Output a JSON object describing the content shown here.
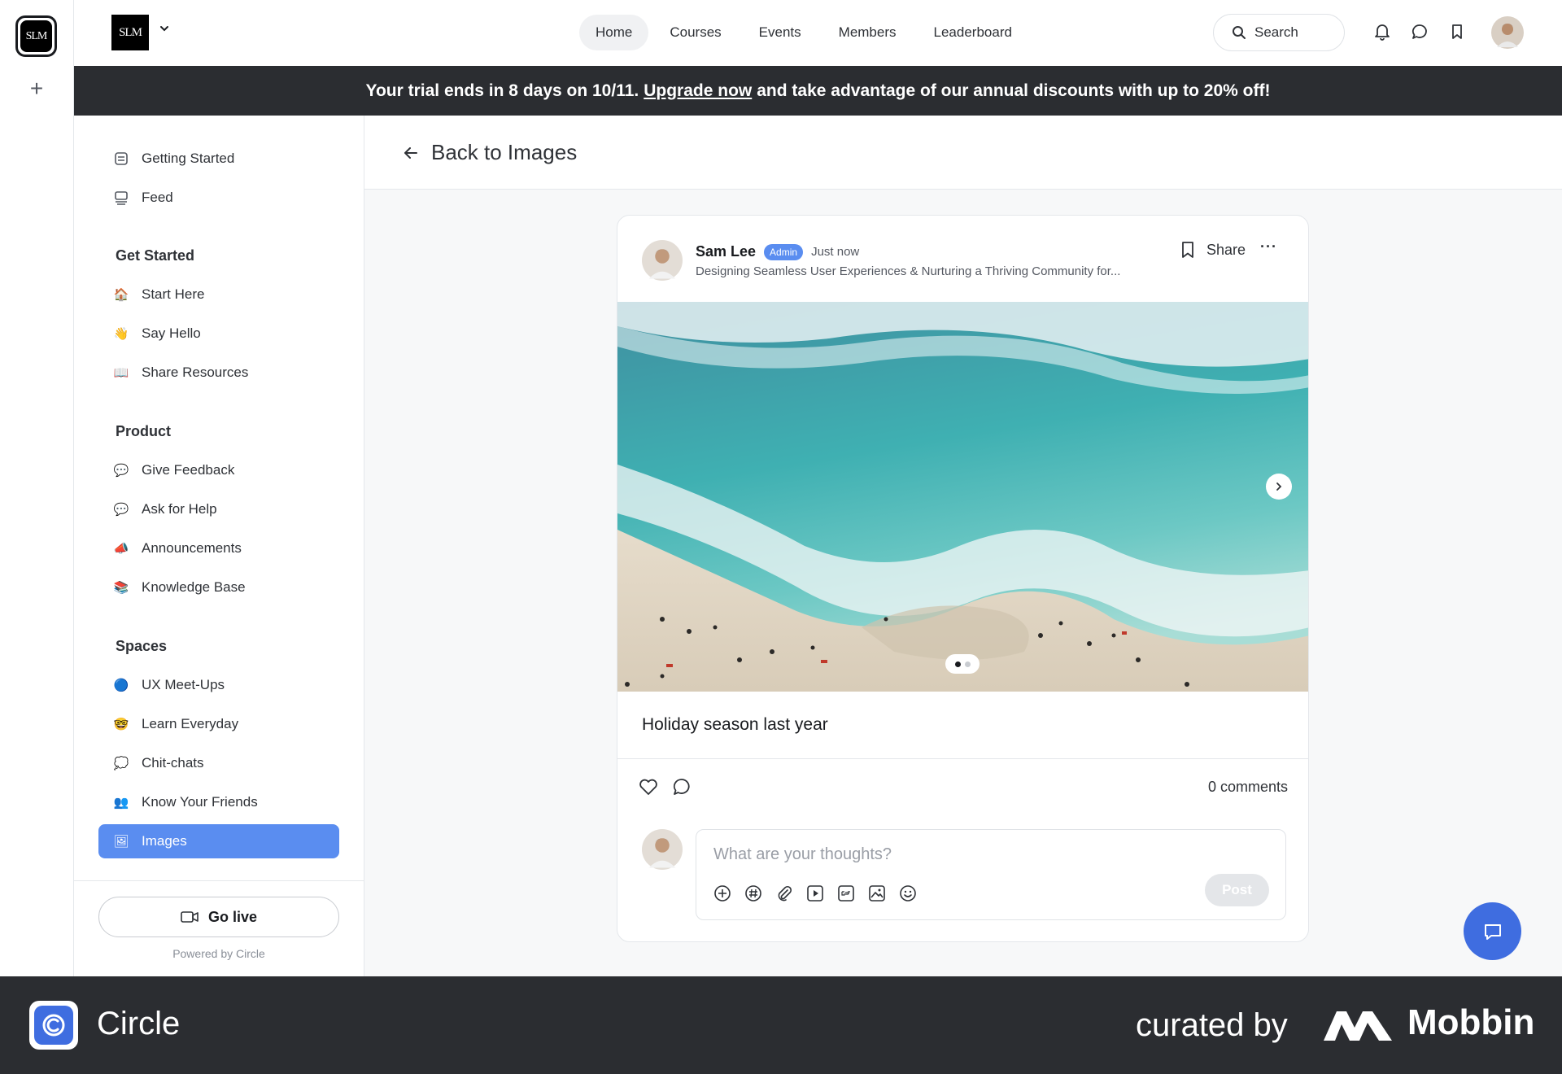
{
  "rail": {
    "logo_text": "SLM",
    "add_label": "+"
  },
  "header": {
    "brand_text": "SLM",
    "nav": [
      "Home",
      "Courses",
      "Events",
      "Members",
      "Leaderboard"
    ],
    "active_nav": "Home",
    "search_label": "Search"
  },
  "banner": {
    "prefix": "Your trial ends in 8 days on 10/11.",
    "link": "Upgrade now",
    "suffix": "and take advantage of our annual discounts with up to 20% off!"
  },
  "sidebar": {
    "top_items": [
      {
        "label": "Getting Started",
        "icon": "checklist-icon"
      },
      {
        "label": "Feed",
        "icon": "feed-icon"
      }
    ],
    "sections": [
      {
        "heading": "Get Started",
        "items": [
          {
            "label": "Start Here",
            "icon": "🏠"
          },
          {
            "label": "Say Hello",
            "icon": "👋"
          },
          {
            "label": "Share Resources",
            "icon": "📖"
          }
        ]
      },
      {
        "heading": "Product",
        "items": [
          {
            "label": "Give Feedback",
            "icon": "💬"
          },
          {
            "label": "Ask for Help",
            "icon": "💬"
          },
          {
            "label": "Announcements",
            "icon": "📣"
          },
          {
            "label": "Knowledge Base",
            "icon": "📚"
          }
        ]
      },
      {
        "heading": "Spaces",
        "items": [
          {
            "label": "UX Meet-Ups",
            "icon": "🔵"
          },
          {
            "label": "Learn Everyday",
            "icon": "🤓"
          },
          {
            "label": "Chit-chats",
            "icon": "💭"
          },
          {
            "label": "Know Your Friends",
            "icon": "👥"
          },
          {
            "label": "Images",
            "icon": "🖼"
          }
        ]
      }
    ],
    "active_item": "Images",
    "go_live": "Go live",
    "powered_by": "Powered by Circle"
  },
  "main": {
    "back_label": "Back to Images",
    "post": {
      "author": "Sam Lee",
      "badge": "Admin",
      "time": "Just now",
      "headline": "Designing Seamless User Experiences & Nurturing a Thriving Community for...",
      "share_label": "Share",
      "more_label": "···",
      "caption": "Holiday season last year",
      "image_index": 1,
      "image_count": 2,
      "comments": "0 comments",
      "comment_placeholder": "What are your thoughts?",
      "post_button": "Post"
    }
  },
  "footer": {
    "app_name": "Circle",
    "curated_by": "curated by",
    "brand": "Mobbin"
  },
  "colors": {
    "accent": "#5a8df0",
    "fab": "#3f6de0",
    "banner": "#2b2d31"
  }
}
